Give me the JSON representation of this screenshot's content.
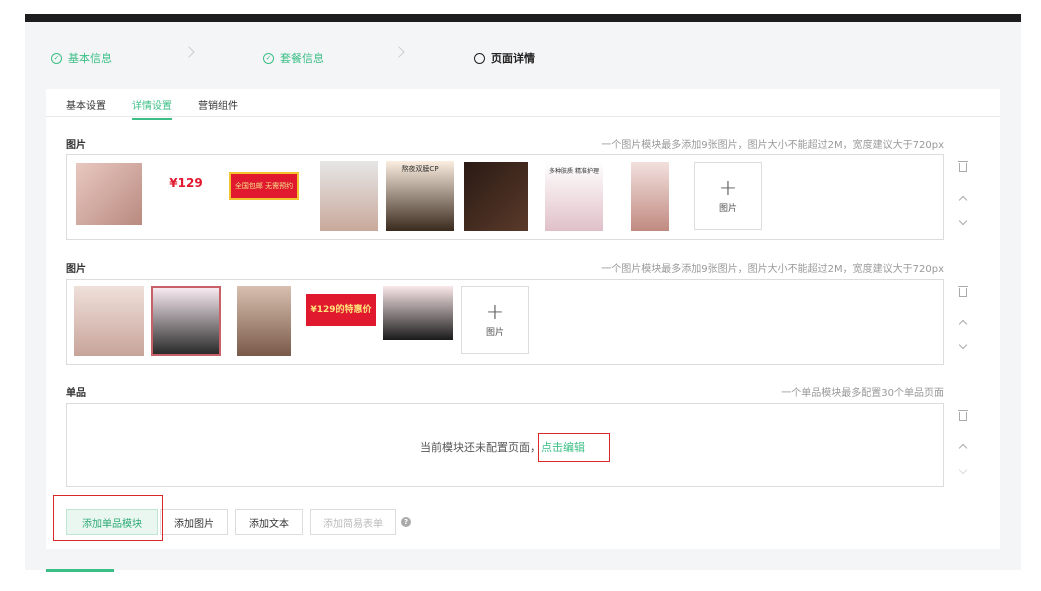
{
  "steps": [
    {
      "label": "基本信息",
      "icon": "check-circle-icon",
      "state": "done"
    },
    {
      "label": "套餐信息",
      "icon": "check-circle-icon",
      "state": "done"
    },
    {
      "label": "页面详情",
      "icon": "circle-icon",
      "state": "current"
    }
  ],
  "tabs": [
    {
      "label": "基本设置"
    },
    {
      "label": "详情设置"
    },
    {
      "label": "营销组件"
    }
  ],
  "sections": [
    {
      "title": "图片",
      "hint": "一个图片模块最多添加9张图片，图片大小不能超过2M，宽度建议大于720px",
      "add_label": "图片"
    },
    {
      "title": "图片",
      "hint": "一个图片模块最多添加9张图片，图片大小不能超过2M，宽度建议大于720px",
      "add_label": "图片"
    },
    {
      "title": "单品",
      "hint": "一个单品模块最多配置30个单品页面",
      "empty_text": "当前模块还未配置页面，",
      "edit_link": "点击编辑"
    }
  ],
  "thumbs1": [
    "",
    "¥129",
    "全国包邮 无需预约",
    "",
    "熬夜双膜CP",
    "",
    "多种肤质 精准护理",
    ""
  ],
  "thumbs2": [
    "",
    "",
    "",
    "¥129的特惠价",
    "",
    ""
  ],
  "buttons": {
    "add_product": "添加单品模块",
    "add_image": "添加图片",
    "add_text": "添加文本",
    "add_form": "添加简易表单"
  },
  "help_glyph": "?",
  "colors": {
    "accent": "#3cbf86",
    "highlight": "#d8282a"
  }
}
